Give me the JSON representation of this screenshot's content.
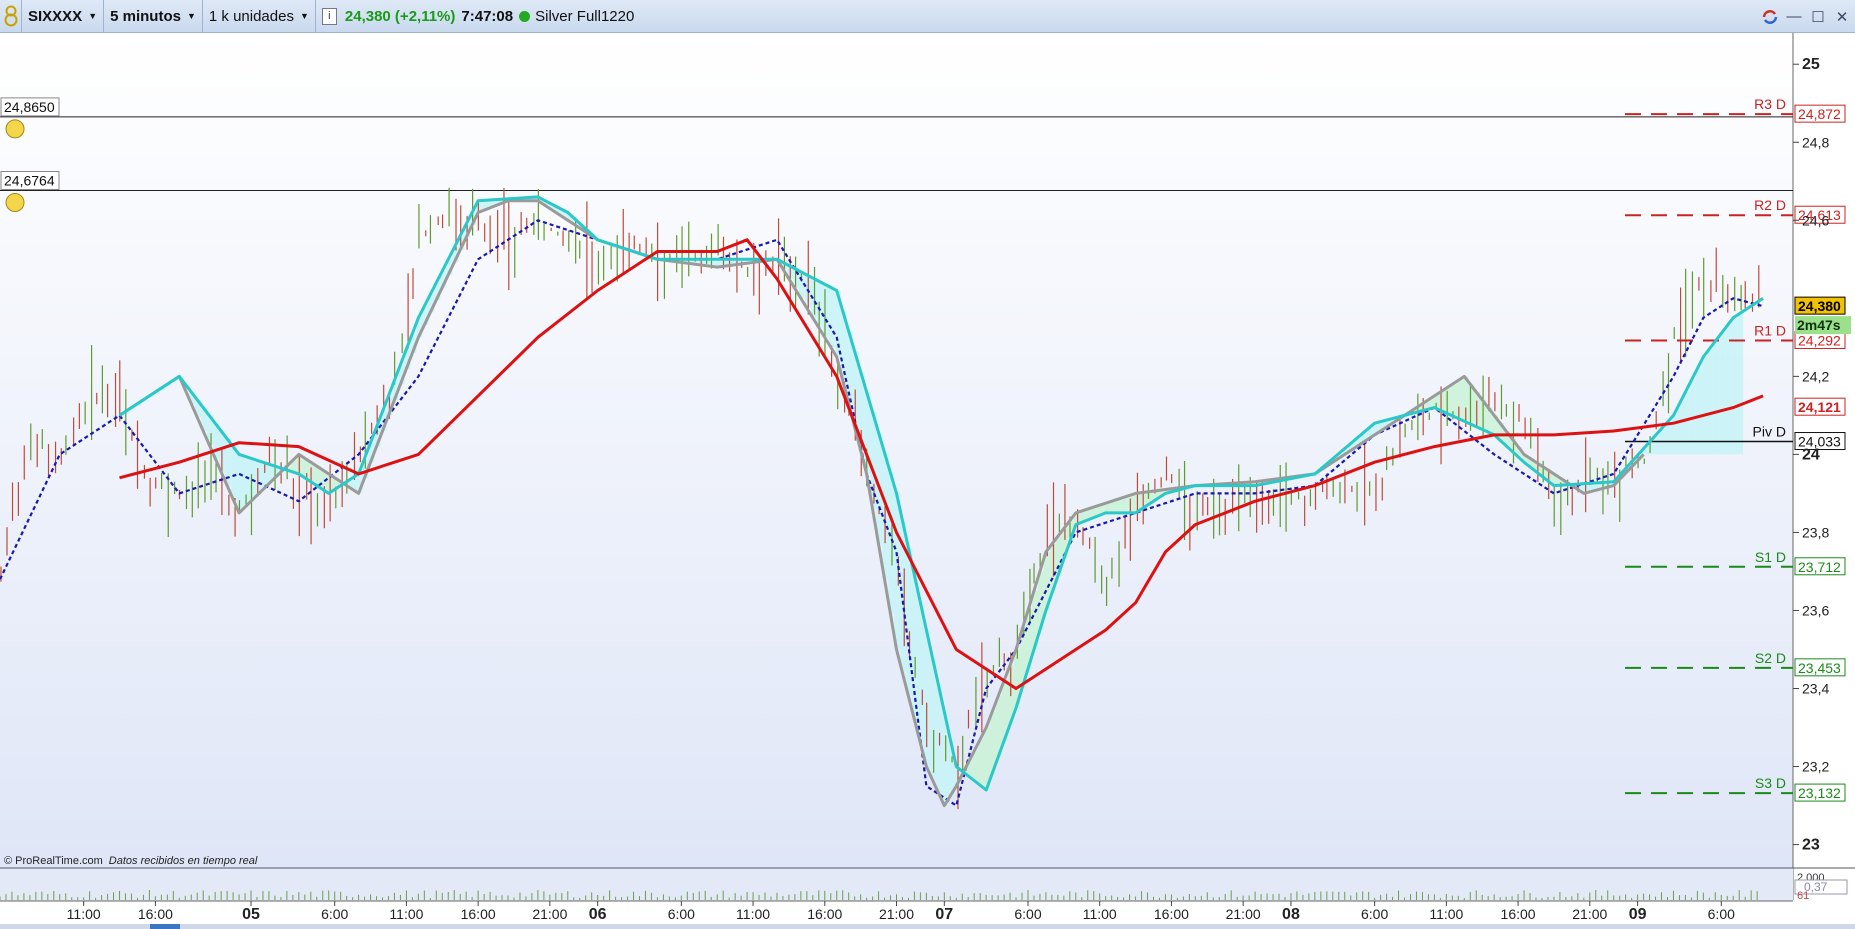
{
  "toolbar": {
    "instrument": "SIXXXX",
    "timeframe": "5 minutos",
    "units": "1 k unidades",
    "info_icon": "info-icon",
    "price": "24,380 (+2,11%)",
    "time": "7:47:08",
    "account": "Silver Full1220",
    "status_color": "#22aa22"
  },
  "window_controls": [
    "sync-icon",
    "minimize-icon",
    "maximize-icon",
    "close-icon"
  ],
  "alerts": [
    {
      "label": "24,8650",
      "value": 24.865,
      "icon": "bell-icon"
    },
    {
      "label": "24,6764",
      "value": 24.6764,
      "icon": "bell-icon"
    }
  ],
  "chart_data": {
    "type": "line",
    "y_axis": {
      "range": [
        22.94,
        25.08
      ],
      "ticks": [
        {
          "value": 25,
          "label": "25",
          "bold": true
        },
        {
          "value": 24.8,
          "label": "24,8"
        },
        {
          "value": 24.6,
          "label": "24,6"
        },
        {
          "value": 24.2,
          "label": "24,2"
        },
        {
          "value": 24,
          "label": "24",
          "bold": true
        },
        {
          "value": 23.8,
          "label": "23,8"
        },
        {
          "value": 23.6,
          "label": "23,6"
        },
        {
          "value": 23.4,
          "label": "23,4"
        },
        {
          "value": 23.2,
          "label": "23,2"
        },
        {
          "value": 23,
          "label": "23",
          "bold": true
        }
      ]
    },
    "x_axis": {
      "labels": [
        {
          "label": "11:00",
          "index": 14
        },
        {
          "label": "16:00",
          "index": 26
        },
        {
          "label": "05",
          "index": 42,
          "bold": true
        },
        {
          "label": "6:00",
          "index": 56
        },
        {
          "label": "11:00",
          "index": 68
        },
        {
          "label": "16:00",
          "index": 80
        },
        {
          "label": "21:00",
          "index": 92
        },
        {
          "label": "06",
          "index": 100,
          "bold": true
        },
        {
          "label": "6:00",
          "index": 114
        },
        {
          "label": "11:00",
          "index": 126
        },
        {
          "label": "16:00",
          "index": 138
        },
        {
          "label": "21:00",
          "index": 150
        },
        {
          "label": "07",
          "index": 158,
          "bold": true
        },
        {
          "label": "6:00",
          "index": 172
        },
        {
          "label": "11:00",
          "index": 184
        },
        {
          "label": "16:00",
          "index": 196
        },
        {
          "label": "21:00",
          "index": 208
        },
        {
          "label": "08",
          "index": 216,
          "bold": true
        },
        {
          "label": "6:00",
          "index": 230
        },
        {
          "label": "11:00",
          "index": 242
        },
        {
          "label": "16:00",
          "index": 254
        },
        {
          "label": "21:00",
          "index": 266
        },
        {
          "label": "09",
          "index": 274,
          "bold": true
        },
        {
          "label": "6:00",
          "index": 288
        }
      ]
    },
    "pivots": [
      {
        "name": "R3 D",
        "value": 24.872,
        "label": "24,872",
        "color": "#cc2222"
      },
      {
        "name": "R2 D",
        "value": 24.613,
        "label": "24,613",
        "color": "#cc2222"
      },
      {
        "name": "R1 D",
        "value": 24.292,
        "label": "24,292",
        "color": "#cc2222"
      },
      {
        "name": "Piv D",
        "value": 24.033,
        "label": "24,033",
        "color": "#111111"
      },
      {
        "name": "S1 D",
        "value": 23.712,
        "label": "23,712",
        "color": "#1a8a1a"
      },
      {
        "name": "S2 D",
        "value": 23.453,
        "label": "23,453",
        "color": "#1a8a1a"
      },
      {
        "name": "S3 D",
        "value": 23.132,
        "label": "23,132",
        "color": "#1a8a1a"
      }
    ],
    "price_tags": [
      {
        "label": "24,380",
        "value": 24.38,
        "bg": "#f2c200",
        "color": "#000000"
      },
      {
        "label": "24,121",
        "value": 24.121,
        "bg": "#ffffff",
        "color": "#cc2222"
      }
    ],
    "countdown": "2m47s",
    "x_index_range": [
      0,
      300
    ],
    "series": [
      {
        "role": "price",
        "color": "#6a9a3a",
        "x": [
          0,
          5,
          10,
          15,
          20,
          25,
          30,
          35,
          40,
          45,
          50,
          55,
          60,
          65,
          70,
          75,
          80,
          85,
          90,
          95,
          100,
          105,
          110,
          115,
          120,
          125,
          130,
          135,
          140,
          145,
          150,
          155,
          160,
          165,
          170,
          175,
          180,
          185,
          190,
          195,
          200,
          205,
          210,
          215,
          220,
          225,
          230,
          235,
          240,
          245,
          250,
          255,
          260,
          265,
          270,
          275,
          280,
          285,
          290,
          295
        ],
        "y": [
          23.7,
          24.05,
          24.0,
          24.15,
          24.12,
          23.92,
          23.9,
          23.95,
          23.85,
          24.0,
          23.9,
          23.88,
          24.0,
          24.15,
          24.55,
          24.62,
          24.58,
          24.55,
          24.6,
          24.55,
          24.5,
          24.55,
          24.5,
          24.52,
          24.52,
          24.48,
          24.5,
          24.45,
          24.2,
          23.95,
          23.7,
          23.3,
          23.2,
          23.45,
          23.5,
          23.8,
          23.85,
          23.65,
          23.9,
          23.95,
          23.85,
          23.85,
          23.92,
          23.88,
          23.9,
          23.92,
          23.9,
          24.05,
          24.12,
          24.1,
          24.15,
          24.08,
          23.9,
          23.92,
          23.95,
          23.98,
          24.3,
          24.45,
          24.38,
          24.38
        ]
      },
      {
        "role": "dotted",
        "color": "#1a1aaa",
        "x": [
          0,
          10,
          20,
          30,
          40,
          50,
          60,
          70,
          80,
          90,
          100,
          110,
          120,
          130,
          140,
          145,
          150,
          155,
          160,
          165,
          170,
          180,
          190,
          200,
          210,
          220,
          230,
          240,
          250,
          260,
          270,
          280,
          285,
          290,
          295
        ],
        "y": [
          23.68,
          24.0,
          24.1,
          23.9,
          23.95,
          23.88,
          24.0,
          24.2,
          24.5,
          24.6,
          24.55,
          24.5,
          24.5,
          24.55,
          24.3,
          23.95,
          23.75,
          23.15,
          23.1,
          23.4,
          23.5,
          23.8,
          23.85,
          23.9,
          23.9,
          23.92,
          24.05,
          24.12,
          24.0,
          23.9,
          23.95,
          24.2,
          24.35,
          24.4,
          24.38
        ]
      },
      {
        "role": "grey",
        "color": "#9a9a9a",
        "x": [
          20,
          25,
          30,
          40,
          50,
          55,
          60,
          70,
          80,
          85,
          90,
          95,
          100,
          110,
          120,
          130,
          140,
          145,
          150,
          155,
          158,
          160,
          165,
          170,
          175,
          180,
          190,
          200,
          210,
          220,
          230,
          240,
          245,
          250,
          255,
          260,
          265,
          270,
          275
        ],
        "y": [
          24.1,
          24.15,
          24.2,
          23.85,
          24.0,
          23.95,
          23.9,
          24.3,
          24.62,
          24.65,
          24.65,
          24.6,
          24.55,
          24.5,
          24.48,
          24.5,
          24.25,
          23.95,
          23.5,
          23.2,
          23.1,
          23.15,
          23.3,
          23.5,
          23.75,
          23.85,
          23.9,
          23.92,
          23.93,
          23.95,
          24.05,
          24.15,
          24.2,
          24.1,
          24.0,
          23.95,
          23.9,
          23.92,
          24.0
        ]
      },
      {
        "role": "cyan",
        "color": "#2ac8c8",
        "x": [
          20,
          25,
          30,
          40,
          50,
          55,
          60,
          70,
          80,
          90,
          95,
          100,
          110,
          120,
          130,
          140,
          150,
          160,
          165,
          170,
          175,
          180,
          185,
          190,
          195,
          200,
          210,
          220,
          230,
          240,
          250,
          255,
          260,
          270,
          280,
          285,
          290,
          295
        ],
        "y": [
          24.1,
          24.15,
          24.2,
          24.0,
          23.95,
          23.9,
          23.95,
          24.35,
          24.65,
          24.66,
          24.62,
          24.55,
          24.5,
          24.5,
          24.5,
          24.42,
          23.9,
          23.2,
          23.14,
          23.35,
          23.6,
          23.82,
          23.85,
          23.85,
          23.9,
          23.92,
          23.92,
          23.95,
          24.08,
          24.12,
          24.05,
          23.98,
          23.92,
          23.93,
          24.1,
          24.25,
          24.35,
          24.4
        ]
      },
      {
        "role": "red",
        "color": "#dd1111",
        "x": [
          20,
          30,
          40,
          50,
          60,
          70,
          80,
          90,
          100,
          110,
          120,
          125,
          130,
          140,
          150,
          160,
          170,
          180,
          185,
          190,
          195,
          200,
          210,
          220,
          230,
          240,
          250,
          260,
          270,
          280,
          290,
          295
        ],
        "y": [
          23.94,
          23.98,
          24.03,
          24.02,
          23.95,
          24.0,
          24.15,
          24.3,
          24.42,
          24.52,
          24.52,
          24.55,
          24.45,
          24.2,
          23.8,
          23.5,
          23.4,
          23.5,
          23.55,
          23.62,
          23.75,
          23.82,
          23.88,
          23.92,
          23.98,
          24.02,
          24.05,
          24.05,
          24.06,
          24.08,
          24.12,
          24.15
        ]
      }
    ],
    "volume_axis": {
      "label": "2.000",
      "indicator": "0,37",
      "indicator2": "61"
    }
  },
  "footer": {
    "copyright": "© ProRealTime.com",
    "realtime_note": "Datos recibidos en tiempo real"
  }
}
